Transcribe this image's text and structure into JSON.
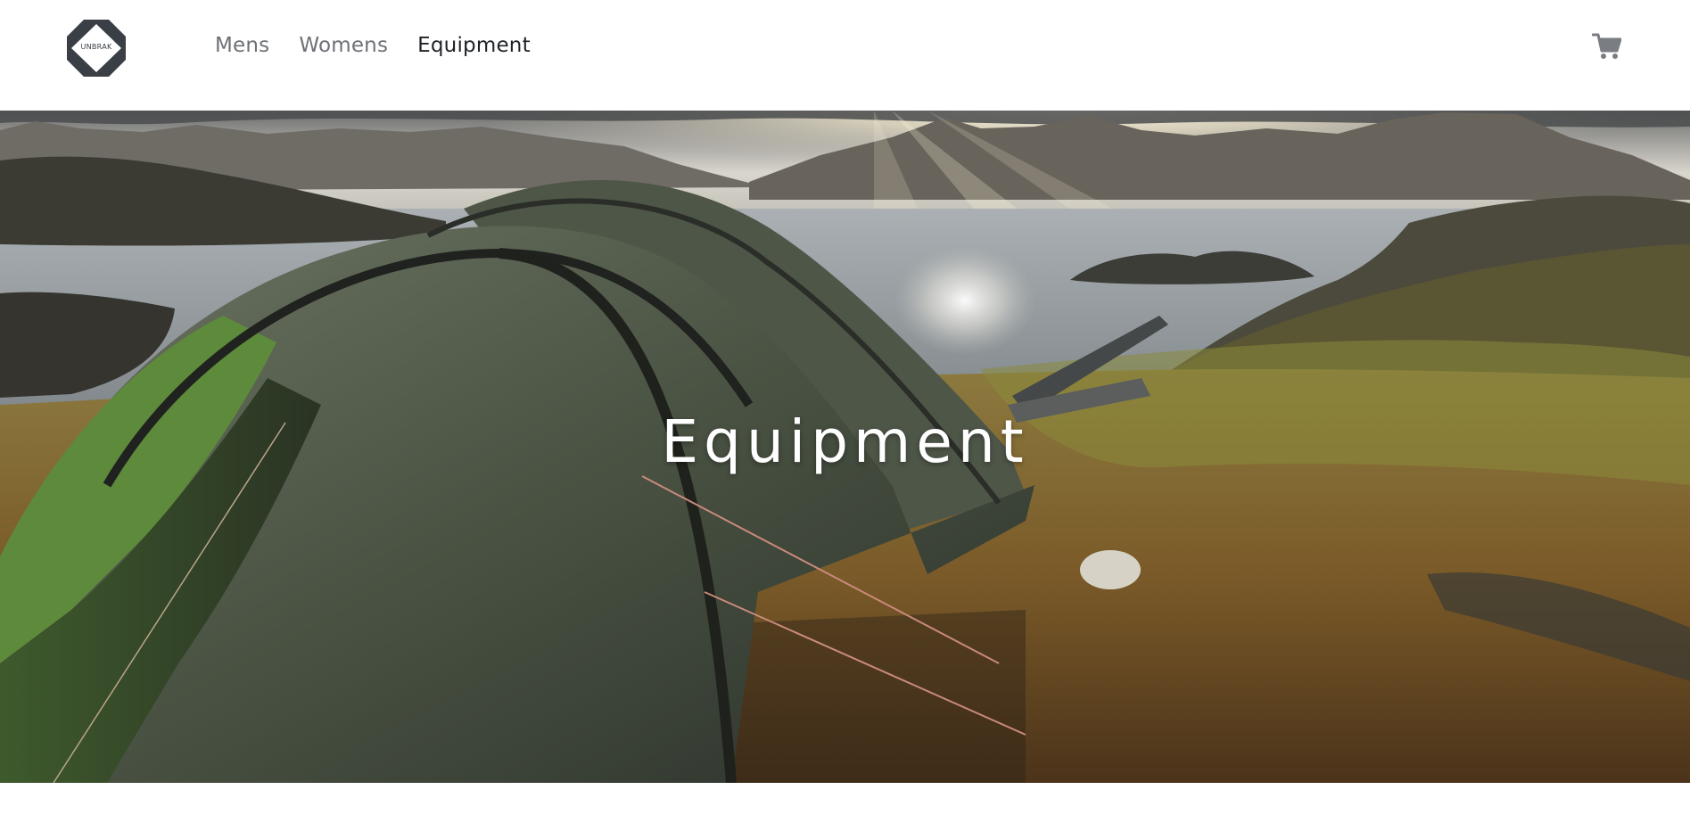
{
  "brand": {
    "logo_text": "UNBRAK"
  },
  "nav": {
    "items": [
      {
        "label": "Mens",
        "active": false
      },
      {
        "label": "Womens",
        "active": false
      },
      {
        "label": "Equipment",
        "active": true
      }
    ]
  },
  "header": {
    "cart_icon": "cart-icon"
  },
  "hero": {
    "title": "Equipment",
    "image_description_icon": "hero-image"
  },
  "colors": {
    "nav_text": "#6d7176",
    "nav_active": "#1f2226",
    "logo_dark": "#3a3f45",
    "cart_icon": "#7a7e83"
  }
}
